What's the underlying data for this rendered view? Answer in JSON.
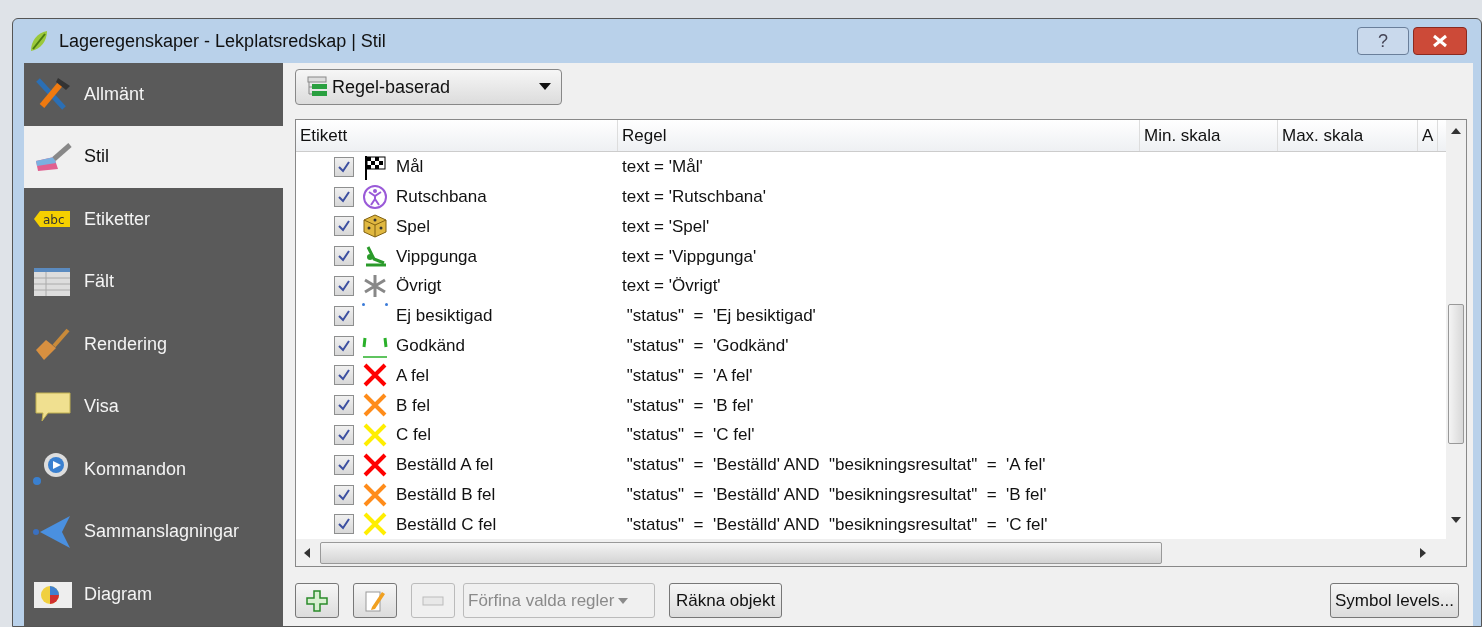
{
  "window": {
    "title": "Lageregenskaper - Lekplatsredskap | Stil",
    "help_button": "?"
  },
  "sidebar": {
    "items": [
      {
        "label": "Allmänt",
        "kind": "tools",
        "selected": false
      },
      {
        "label": "Stil",
        "kind": "brush",
        "selected": true
      },
      {
        "label": "Etiketter",
        "kind": "abc",
        "selected": false
      },
      {
        "label": "Fält",
        "kind": "table",
        "selected": false
      },
      {
        "label": "Rendering",
        "kind": "paintbrush",
        "selected": false
      },
      {
        "label": "Visa",
        "kind": "speech",
        "selected": false
      },
      {
        "label": "Kommandon",
        "kind": "gear",
        "selected": false
      },
      {
        "label": "Sammanslagningar",
        "kind": "arrow",
        "selected": false
      },
      {
        "label": "Diagram",
        "kind": "chart",
        "selected": false
      }
    ]
  },
  "renderer_select": {
    "value": "Regel-baserad"
  },
  "table": {
    "columns": [
      "Etikett",
      "Regel",
      "Min. skala",
      "Max. skala",
      "A"
    ],
    "rows": [
      {
        "checked": true,
        "kind": "flag",
        "label": "Mål",
        "rule": "text = 'Mål'"
      },
      {
        "checked": true,
        "kind": "person",
        "label": "Rutschbana",
        "rule": "text = 'Rutschbana'"
      },
      {
        "checked": true,
        "kind": "dice",
        "label": "Spel",
        "rule": "text = 'Spel'"
      },
      {
        "checked": true,
        "kind": "swing",
        "label": "Vippgunga",
        "rule": "text = 'Vippgunga'"
      },
      {
        "checked": true,
        "kind": "asterisk",
        "label": "Övrigt",
        "rule": "text = 'Övrigt'"
      },
      {
        "checked": true,
        "kind": "dots",
        "label": "Ej besiktigad",
        "rule": " \"status\"  =  'Ej besiktigad'"
      },
      {
        "checked": true,
        "kind": "corners",
        "label": "Godkänd",
        "rule": " \"status\"  =  'Godkänd'"
      },
      {
        "checked": true,
        "kind": "cross",
        "color": "#ff0000",
        "label": "A fel",
        "rule": " \"status\"  =  'A fel'"
      },
      {
        "checked": true,
        "kind": "cross",
        "color": "#ff8c1a",
        "label": "B fel",
        "rule": " \"status\"  =  'B fel'"
      },
      {
        "checked": true,
        "kind": "cross",
        "color": "#ffee00",
        "label": "C fel",
        "rule": " \"status\"  =  'C fel'"
      },
      {
        "checked": true,
        "kind": "cross",
        "color": "#ff0000",
        "label": "Beställd A fel",
        "rule": " \"status\"  =  'Beställd' AND  \"besikningsresultat\"  =  'A fel'"
      },
      {
        "checked": true,
        "kind": "cross",
        "color": "#ff8c1a",
        "label": "Beställd B fel",
        "rule": " \"status\"  =  'Beställd' AND  \"besikningsresultat\"  =  'B fel'"
      },
      {
        "checked": true,
        "kind": "cross",
        "color": "#ffee00",
        "label": "Beställd C fel",
        "rule": " \"status\"  =  'Beställd' AND  \"besikningsresultat\"  =  'C fel'"
      }
    ]
  },
  "buttons": {
    "refine": {
      "label": "Förfina valda regler",
      "disabled": true
    },
    "remove": {
      "disabled": true
    },
    "count": "Räkna objekt",
    "symbol_levels": "Symbol levels..."
  }
}
